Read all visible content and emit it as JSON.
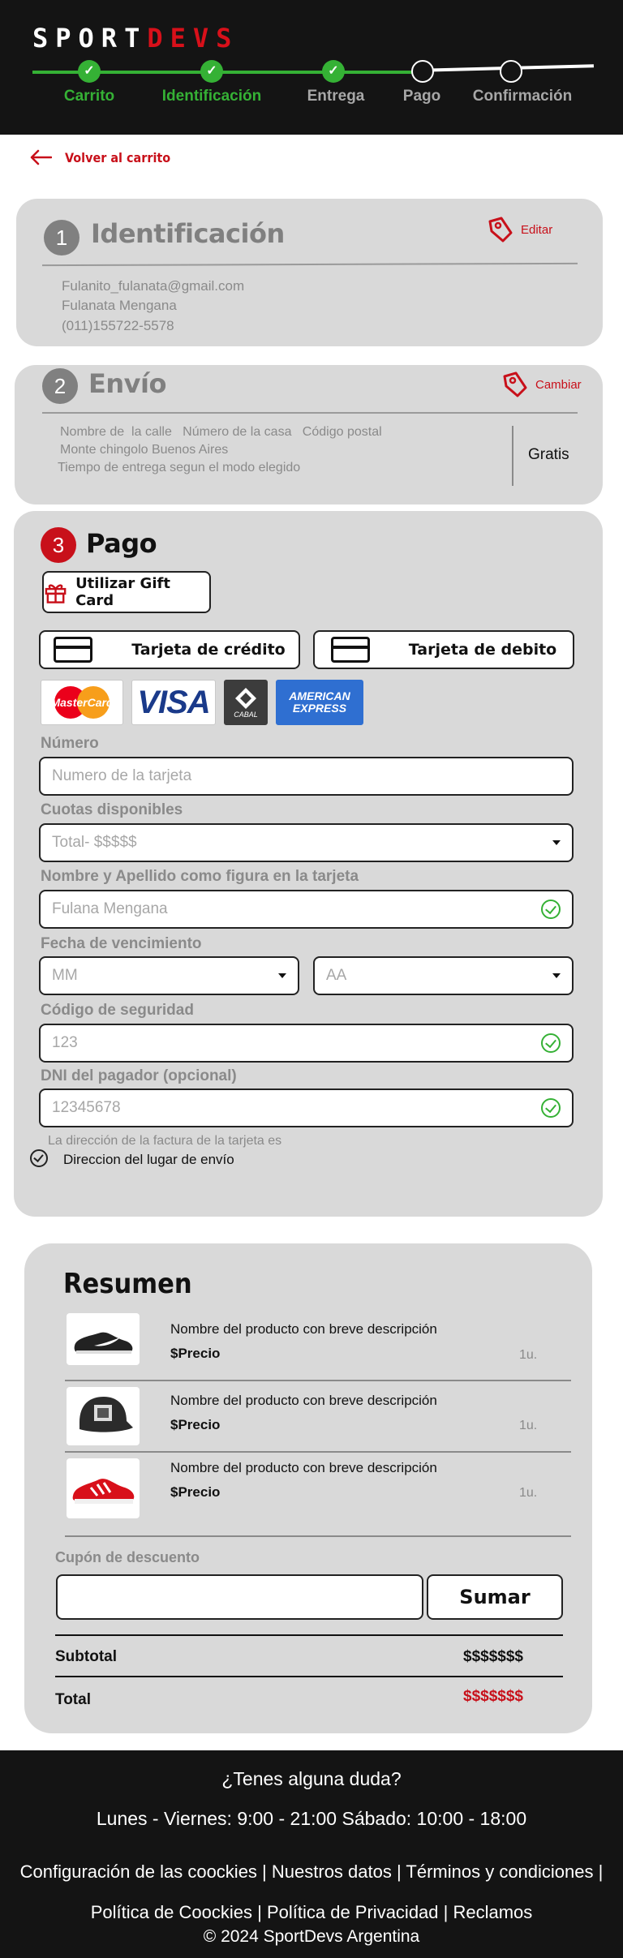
{
  "brand": {
    "part1": "SPORT",
    "part2": "DEVS"
  },
  "steps": [
    {
      "label": "Carrito",
      "state": "done"
    },
    {
      "label": "Identificación",
      "state": "done"
    },
    {
      "label": "Entrega",
      "state": "done"
    },
    {
      "label": "Pago",
      "state": "todo"
    },
    {
      "label": "Confirmación",
      "state": "todo"
    }
  ],
  "back": {
    "label": "Volver al carrito"
  },
  "identification": {
    "number": "1",
    "title": "Identificación",
    "action": "Editar",
    "email": "Fulanito_fulanata@gmail.com",
    "name": "Fulanata Mengana",
    "phone": "(011)155722-5578"
  },
  "shipping": {
    "number": "2",
    "title": "Envío",
    "action": "Cambiar",
    "line1": "Nombre de  la calle   Número de la casa   Código postal",
    "line2": "Monte chingolo Buenos Aires",
    "line3": "Tiempo de entrega segun el modo elegido",
    "cost": "Gratis"
  },
  "payment": {
    "number": "3",
    "title": "Pago",
    "gift_card": "Utilizar Gift Card",
    "credit": "Tarjeta de crédito",
    "debit": "Tarjeta de debito",
    "brands": {
      "mastercard": "MasterCard",
      "visa": "VISA",
      "cabal": "CABAL",
      "amex_1": "AMERICAN",
      "amex_2": "EXPRESS"
    },
    "number_label": "Número",
    "number_placeholder": "Numero de la tarjeta",
    "installments_label": "Cuotas disponibles",
    "installments_value": "Total- $$$$$",
    "holder_label": "Nombre y Apellido como figura en la tarjeta",
    "holder_value": "Fulana Mengana",
    "expiry_label": "Fecha de vencimiento",
    "expiry_month": "MM",
    "expiry_year": "AA",
    "cvv_label": "Código de seguridad",
    "cvv_value": "123",
    "dni_label": "DNI del pagador (opcional)",
    "dni_value": "12345678",
    "billing_note": "La dirección de la factura de la tarjeta es",
    "billing_option": "Direccion del lugar de envío"
  },
  "summary": {
    "title": "Resumen",
    "products": [
      {
        "name": "Nombre del producto con breve descripción",
        "price": "$Precio",
        "qty": "1u."
      },
      {
        "name": "Nombre del producto con breve descripción",
        "price": "$Precio",
        "qty": "1u."
      },
      {
        "name": "Nombre del producto con breve descripción",
        "price": "$Precio",
        "qty": "1u."
      }
    ],
    "coupon_label": "Cupón de descuento",
    "coupon_button": "Sumar",
    "subtotal_label": "Subtotal",
    "subtotal_value": "$$$$$$$",
    "total_label": "Total",
    "total_value": "$$$$$$$"
  },
  "footer": {
    "question": "¿Tenes alguna duda?",
    "hours": "Lunes - Viernes: 9:00 - 21:00 Sábado: 10:00 - 18:00",
    "links": [
      "Configuración de las coockies",
      "Nuestros datos",
      "Términos y condiciones",
      "Política de Coockies",
      "Política de Privacidad",
      "Reclamos"
    ],
    "copyright": "©  2024  SportDevs Argentina"
  },
  "colors": {
    "accent_red": "#c8101a",
    "success_green": "#35b135",
    "card_gray": "#d9d9d9",
    "header_black": "#141414"
  },
  "icons": [
    "check-icon",
    "arrow-left-icon",
    "edit-tag-icon",
    "gift-icon",
    "credit-card-icon",
    "chevron-down-icon",
    "check-circle-icon"
  ]
}
